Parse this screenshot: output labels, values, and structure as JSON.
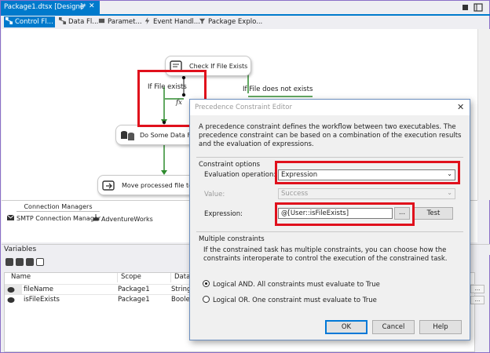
{
  "document_tab": {
    "title": "Package1.dtsx [Design]*",
    "pin_glyph": "⊕",
    "close_glyph": "✕"
  },
  "designer_tabs": [
    {
      "label": "Control Fl...",
      "icon": "control-flow-icon"
    },
    {
      "label": "Data Fl...",
      "icon": "data-flow-icon"
    },
    {
      "label": "Paramet...",
      "icon": "parameters-icon"
    },
    {
      "label": "Event Handl...",
      "icon": "event-handlers-icon"
    },
    {
      "label": "Package Explo...",
      "icon": "package-explorer-icon"
    }
  ],
  "canvas": {
    "tasks": [
      {
        "label": "Check If File Exists"
      },
      {
        "label": "Do Some Data Flow T"
      },
      {
        "label": "Move processed file to Proc"
      }
    ],
    "constraint_labels": {
      "file_exists": "If File exists",
      "file_not_exists": "If File does not exists",
      "fx": "fx"
    }
  },
  "connection_managers": {
    "tab_label": "Connection Managers",
    "items": [
      {
        "label": "SMTP Connection Manager",
        "icon": "smtp-icon"
      },
      {
        "label": "AdventureWorks",
        "icon": "database-connection-icon"
      }
    ]
  },
  "variables": {
    "title": "Variables",
    "columns": [
      "Name",
      "Scope",
      "Data t"
    ],
    "rows": [
      {
        "name": "fileName",
        "scope": "Package1",
        "type": "String"
      },
      {
        "name": "isFileExists",
        "scope": "Package1",
        "type": "Boole"
      }
    ],
    "ellipsis": "..."
  },
  "dialog": {
    "title": "Precedence Constraint Editor",
    "close_glyph": "✕",
    "description": "A precedence constraint defines the workflow between two executables. The precedence constraint can be based on a combination of the execution results and the evaluation of expressions.",
    "constraint_options_title": "Constraint options",
    "evaluation_label": "Evaluation operation:",
    "evaluation_value": "Expression",
    "value_label": "Value:",
    "value_value": "Success",
    "expression_label": "Expression:",
    "expression_value": "@[User::isFileExists]",
    "ellipsis_label": "...",
    "test_label": "Test",
    "multiple_title": "Multiple constraints",
    "multiple_desc": "If the constrained task has multiple constraints, you can choose how the constraints interoperate to control the execution of the constrained task.",
    "radio_and": "Logical AND. All constraints must evaluate to True",
    "radio_or": "Logical OR. One constraint must evaluate to True",
    "ok_label": "OK",
    "cancel_label": "Cancel",
    "help_label": "Help",
    "dropdown_glyph": "⌄"
  },
  "colors": {
    "accent": "#007acc",
    "highlight_red": "#e0101c",
    "flow_green": "#2e8b2e"
  }
}
